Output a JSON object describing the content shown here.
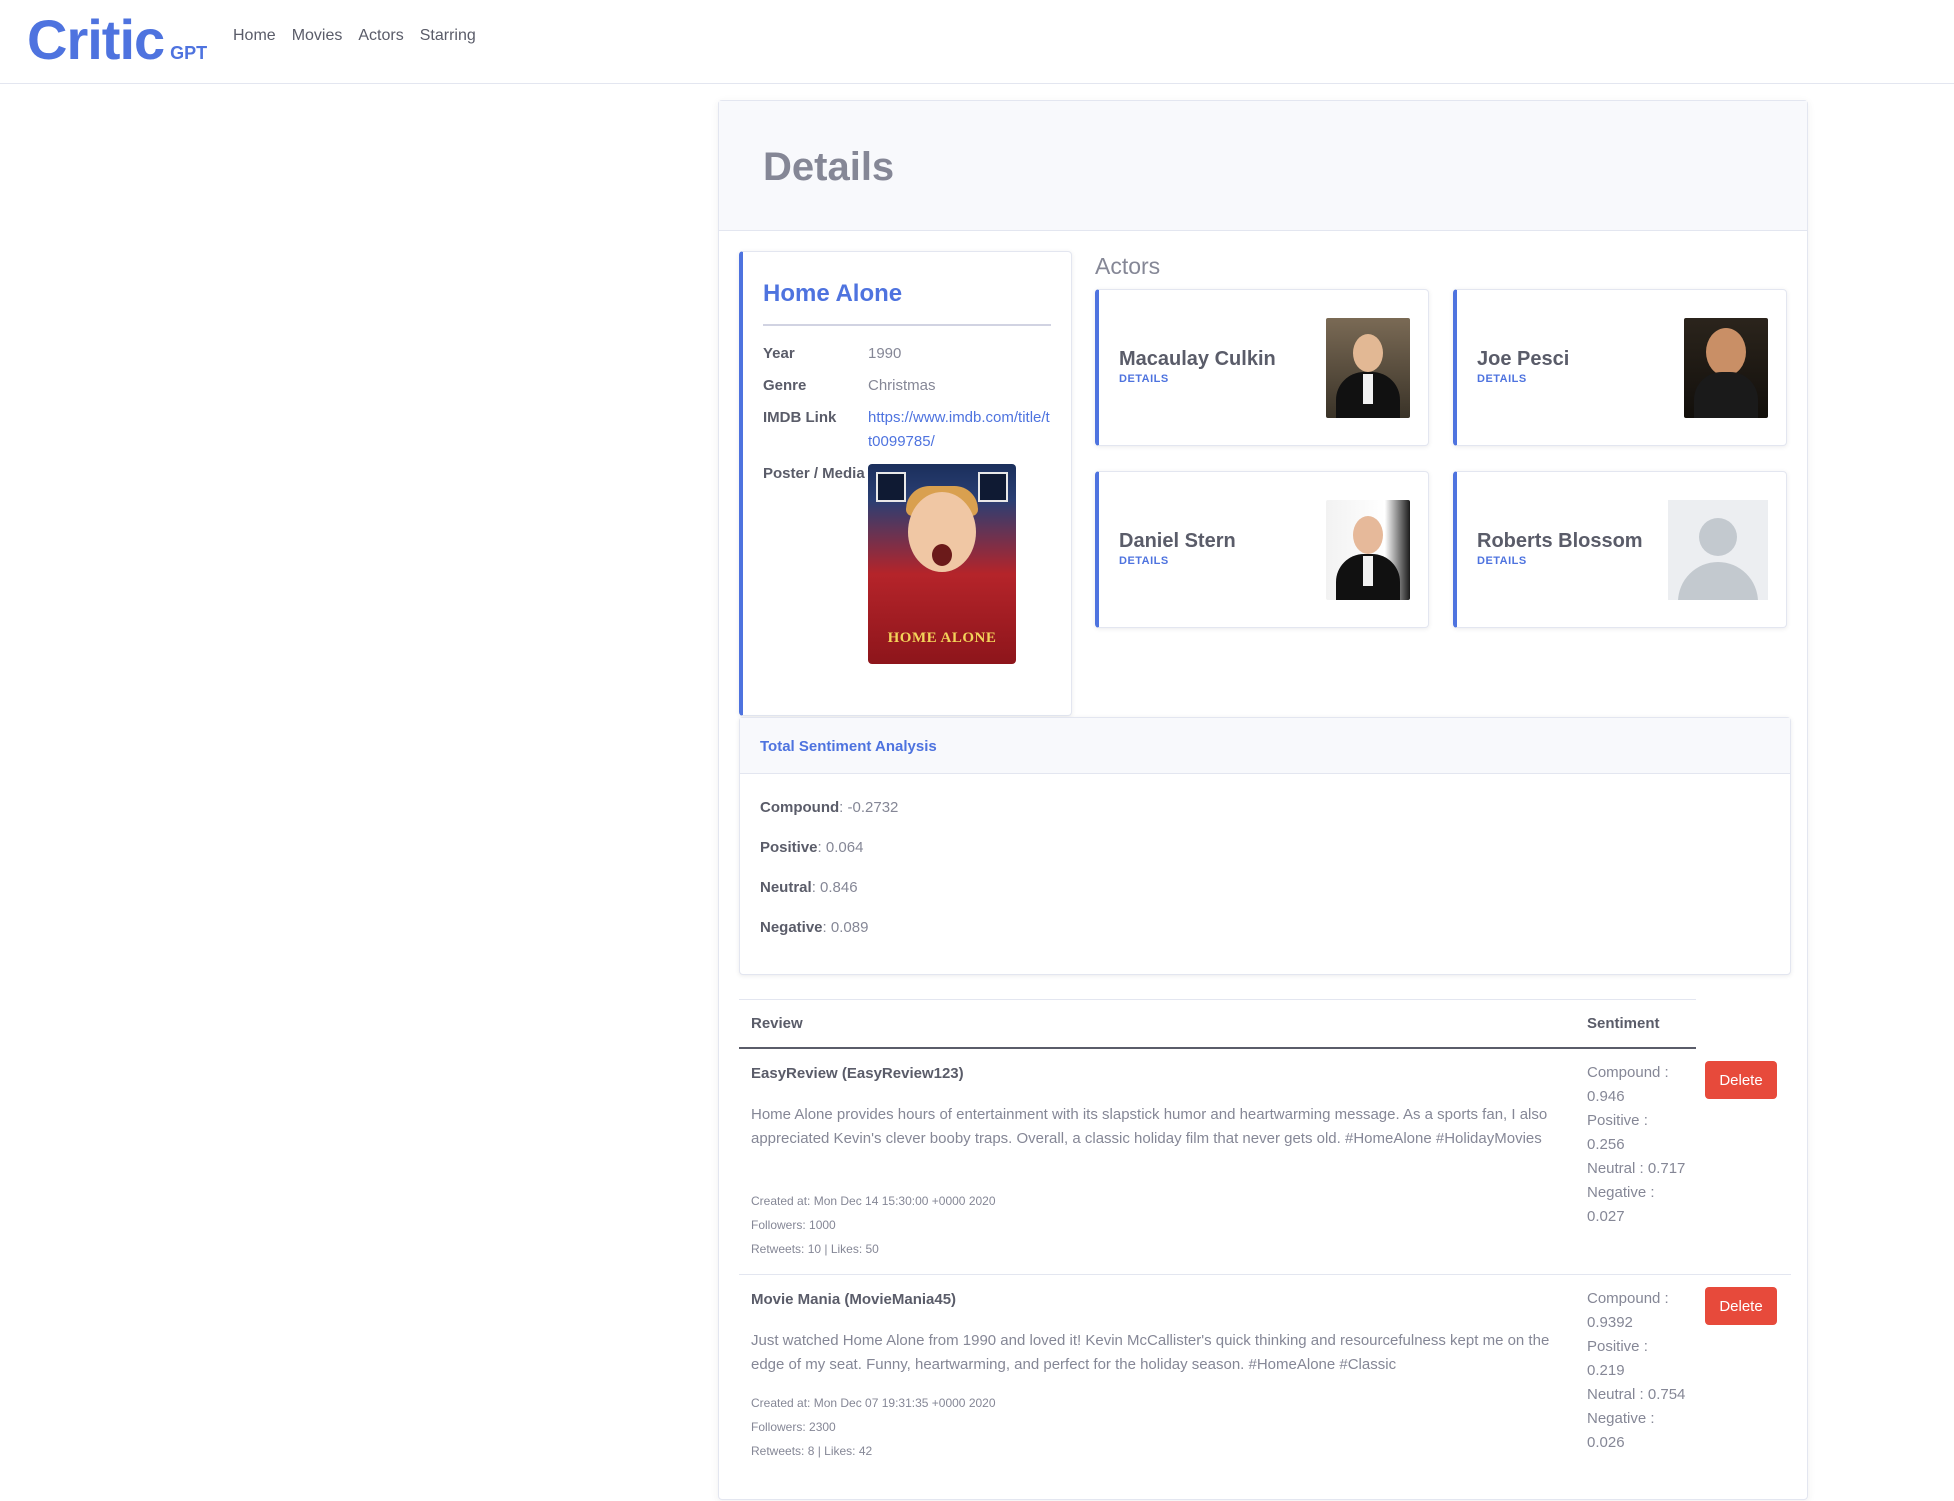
{
  "navbar": {
    "brand_main": "Critic",
    "brand_sub": "GPT",
    "links": [
      "Home",
      "Movies",
      "Actors",
      "Starring"
    ]
  },
  "page": {
    "title": "Details"
  },
  "movie": {
    "title": "Home Alone",
    "labels": {
      "year": "Year",
      "genre": "Genre",
      "imdb": "IMDB Link",
      "poster": "Poster / Media"
    },
    "year": "1990",
    "genre": "Christmas",
    "imdb_link": "https://www.imdb.com/title/tt0099785/",
    "poster_text": "HOME ALONE"
  },
  "actors": {
    "heading": "Actors",
    "details_label": "DETAILS",
    "items": [
      {
        "name": "Macaulay Culkin"
      },
      {
        "name": "Joe Pesci"
      },
      {
        "name": "Daniel Stern"
      },
      {
        "name": "Roberts Blossom"
      }
    ]
  },
  "sentiment": {
    "title": "Total Sentiment Analysis",
    "compound_label": "Compound",
    "compound": "-0.2732",
    "positive_label": "Positive",
    "positive": "0.064",
    "neutral_label": "Neutral",
    "neutral": "0.846",
    "negative_label": "Negative",
    "negative": "0.089"
  },
  "reviews": {
    "col_review": "Review",
    "col_sentiment": "Sentiment",
    "delete_label": "Delete",
    "items": [
      {
        "user": "EasyReview (EasyReview123)",
        "text": "Home Alone provides hours of entertainment with its slapstick humor and heartwarming message. As a sports fan, I also appreciated Kevin's clever booby traps. Overall, a classic holiday film that never gets old. #HomeAlone #HolidayMovies",
        "created": "Created at: Mon Dec 14 15:30:00 +0000 2020",
        "followers": "Followers: 1000",
        "engagement": "Retweets: 10 | Likes: 50",
        "compound": "Compound : 0.946",
        "positive": "Positive : 0.256",
        "neutral": "Neutral : 0.717",
        "negative": "Negative : 0.027"
      },
      {
        "user": "Movie Mania (MovieMania45)",
        "text": "Just watched Home Alone from 1990 and loved it! Kevin McCallister's quick thinking and resourcefulness kept me on the edge of my seat. Funny, heartwarming, and perfect for the holiday season. #HomeAlone #Classic",
        "created": "Created at: Mon Dec 07 19:31:35 +0000 2020",
        "followers": "Followers: 2300",
        "engagement": "Retweets: 8 | Likes: 42",
        "compound": "Compound : 0.9392",
        "positive": "Positive : 0.219",
        "neutral": "Neutral : 0.754",
        "negative": "Negative : 0.026"
      }
    ]
  }
}
